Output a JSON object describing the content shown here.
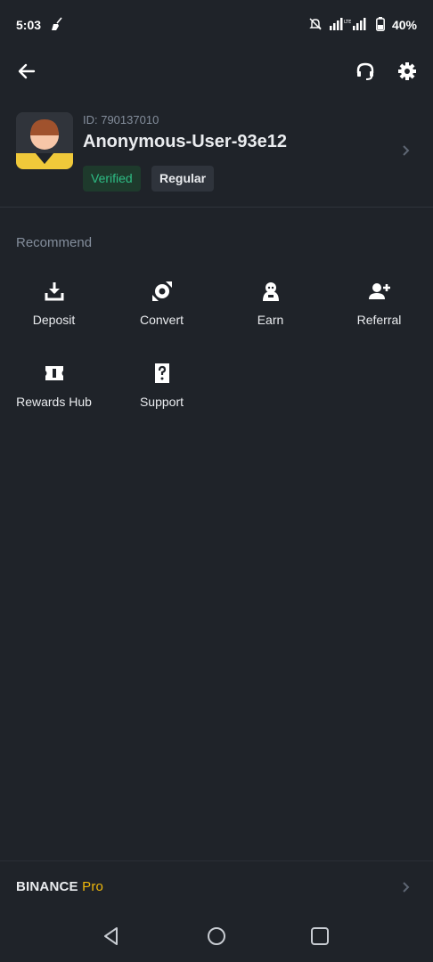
{
  "status_bar": {
    "time": "5:03",
    "battery": "40%"
  },
  "profile": {
    "id_text": "ID: 790137010",
    "username": "Anonymous-User-93e12",
    "badges": [
      "Verified",
      "Regular"
    ]
  },
  "recommend": {
    "title": "Recommend",
    "items": [
      {
        "label": "Deposit",
        "icon": "download-icon"
      },
      {
        "label": "Convert",
        "icon": "convert-icon"
      },
      {
        "label": "Earn",
        "icon": "earn-icon"
      },
      {
        "label": "Referral",
        "icon": "add-user-icon"
      },
      {
        "label": "Rewards Hub",
        "icon": "ticket-icon"
      },
      {
        "label": "Support",
        "icon": "help-icon"
      }
    ]
  },
  "footer": {
    "brand": "BINANCE",
    "brand_suffix": "Pro"
  },
  "colors": {
    "background": "#1f2329",
    "accent": "#f0b90b",
    "verified": "#2ebd85",
    "muted": "#848e9c"
  }
}
